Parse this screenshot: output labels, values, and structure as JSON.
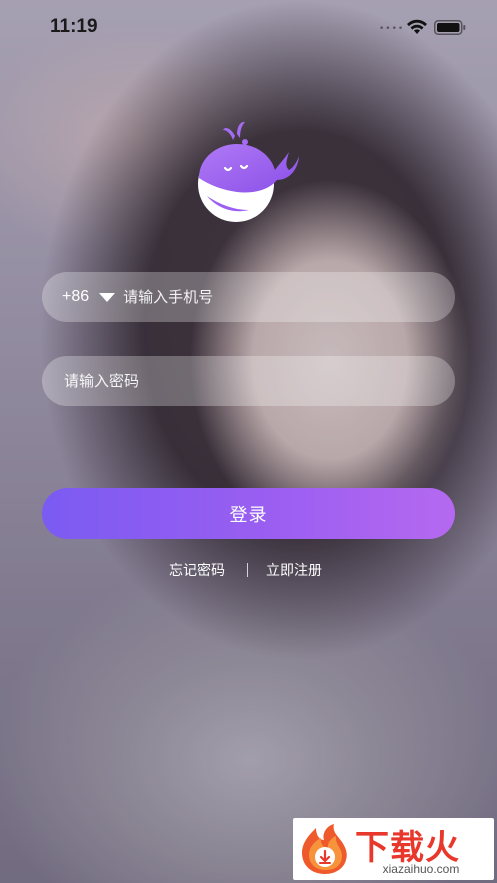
{
  "status_bar": {
    "time": "11:19",
    "signal_dots": "••••",
    "wifi_icon": "wifi-icon",
    "battery_icon": "battery-icon"
  },
  "logo": {
    "icon": "whale-logo-icon",
    "colors": {
      "primary": "#9b5ff2",
      "light": "#ffffff"
    }
  },
  "form": {
    "phone": {
      "country_code": "+86",
      "placeholder": "请输入手机号",
      "value": ""
    },
    "password": {
      "placeholder": "请输入密码",
      "value": ""
    },
    "login_label": "登录",
    "login_colors": {
      "start": "#7b5bf2",
      "end": "#b569f0"
    }
  },
  "links": {
    "forgot_password": "忘记密码",
    "register": "立即注册"
  },
  "watermark": {
    "logo_icon": "download-flame-icon",
    "text": "下载火",
    "domain": "xiazaihuo.com",
    "color": "#e8382c"
  }
}
